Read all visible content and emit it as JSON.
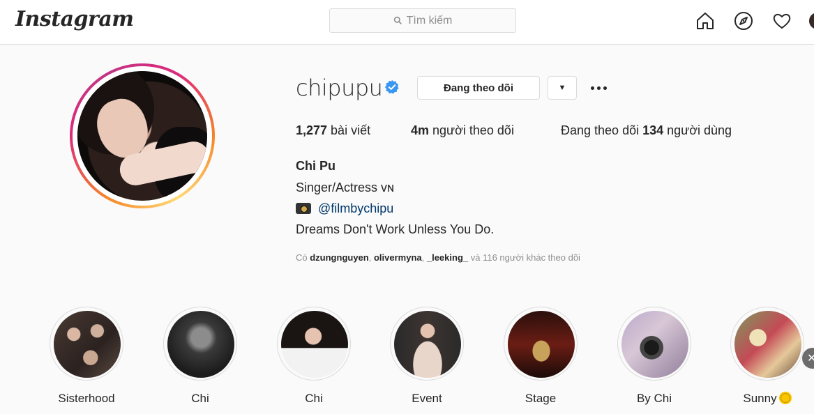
{
  "nav": {
    "logo": "Instagram",
    "search_placeholder": "Tìm kiếm",
    "icons": [
      "home-icon",
      "explore-icon",
      "activity-heart-icon",
      "profile-avatar"
    ]
  },
  "profile": {
    "username": "chipupu",
    "verified": true,
    "follow_button": "Đang theo dõi",
    "dropdown_glyph": "▼",
    "stats": {
      "posts_count": "1,277",
      "posts_label": " bài viết",
      "followers_count": "4m",
      "followers_label": " người theo dõi",
      "following_prefix": "Đang theo dõi ",
      "following_count": "134",
      "following_suffix": " người dùng"
    },
    "full_name": "Chi Pu",
    "bio_line1": "Singer/Actress ᴠɴ",
    "bio_link": "@filmbychipu",
    "bio_line3": "Dreams Don't Work Unless You Do.",
    "followed_by": {
      "prefix": "Có ",
      "user1": "dzungnguyen",
      "sep1": ", ",
      "user2": "olivermyna",
      "sep2": ", ",
      "user3": "_leeking_",
      "suffix": " và 116 người khác theo dõi"
    }
  },
  "highlights": [
    {
      "label": "Sisterhood"
    },
    {
      "label": "Chi"
    },
    {
      "label": "Chi"
    },
    {
      "label": "Event"
    },
    {
      "label": "Stage"
    },
    {
      "label": "By Chi"
    },
    {
      "label": "Sunny"
    }
  ],
  "colors": {
    "accent_link": "#00376b",
    "verified_blue": "#3897f0",
    "border": "#dbdbdb",
    "muted_text": "#8e8e8e"
  }
}
